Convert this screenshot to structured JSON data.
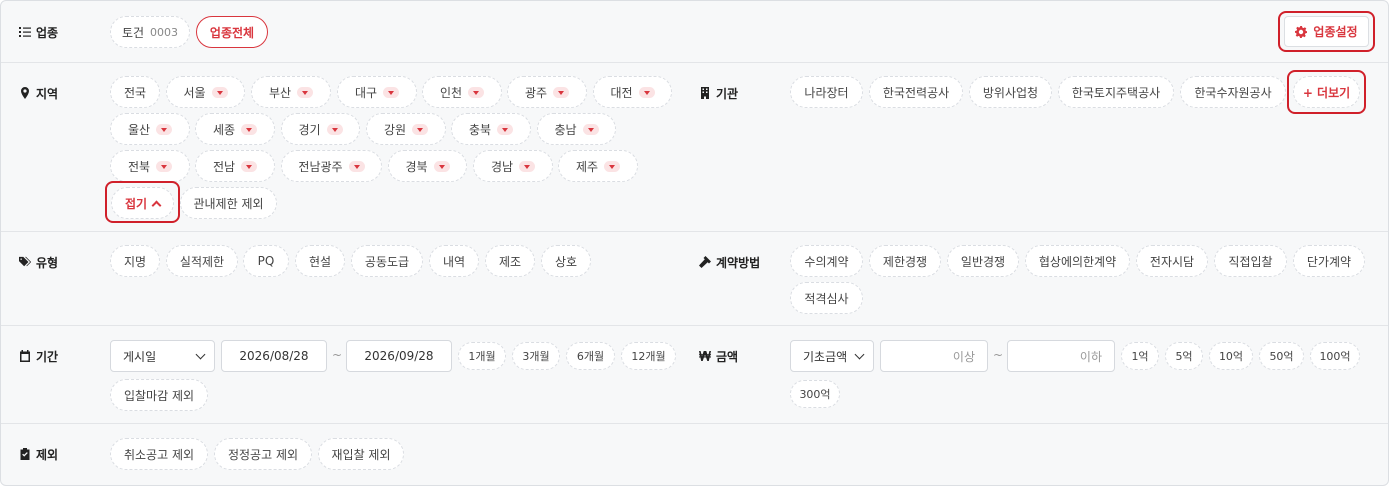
{
  "industry": {
    "label": "업종",
    "chips": [
      {
        "text": "토건",
        "num": "0003"
      }
    ],
    "all_label": "업종전체",
    "settings_label": "업종설정"
  },
  "region": {
    "label": "지역",
    "row1": [
      "전국",
      "서울",
      "부산",
      "대구",
      "인천",
      "광주",
      "대전"
    ],
    "row2": [
      "울산",
      "세종",
      "경기",
      "강원",
      "충북",
      "충남"
    ],
    "row3": [
      "전북",
      "전남",
      "전남광주",
      "경북",
      "경남",
      "제주"
    ],
    "fold_label": "접기",
    "exclude_label": "관내제한 제외"
  },
  "agency": {
    "label": "기관",
    "chips": [
      "나라장터",
      "한국전력공사",
      "방위사업청",
      "한국토지주택공사",
      "한국수자원공사"
    ],
    "more_label": "+ 더보기"
  },
  "type": {
    "label": "유형",
    "chips": [
      "지명",
      "실적제한",
      "PQ",
      "현설",
      "공동도급",
      "내역",
      "제조",
      "상호"
    ]
  },
  "contract": {
    "label": "계약방법",
    "chips": [
      "수의계약",
      "제한경쟁",
      "일반경쟁",
      "협상에의한계약",
      "전자시담",
      "직접입찰",
      "단가계약",
      "적격심사"
    ]
  },
  "period": {
    "label": "기간",
    "select_value": "게시일",
    "start": "2026/08/28",
    "tilde": "~",
    "end": "2026/09/28",
    "chips": [
      "1개월",
      "3개월",
      "6개월",
      "12개월"
    ],
    "exclude_label": "입찰마감 제외"
  },
  "amount": {
    "label": "금액",
    "select_value": "기초금액",
    "min_placeholder": "이상",
    "tilde": "~",
    "max_placeholder": "이하",
    "chips": [
      "1억",
      "5억",
      "10억",
      "50억",
      "100억",
      "300억"
    ]
  },
  "exclude": {
    "label": "제외",
    "chips": [
      "취소공고 제외",
      "정정공고 제외",
      "재입찰 제외"
    ]
  }
}
